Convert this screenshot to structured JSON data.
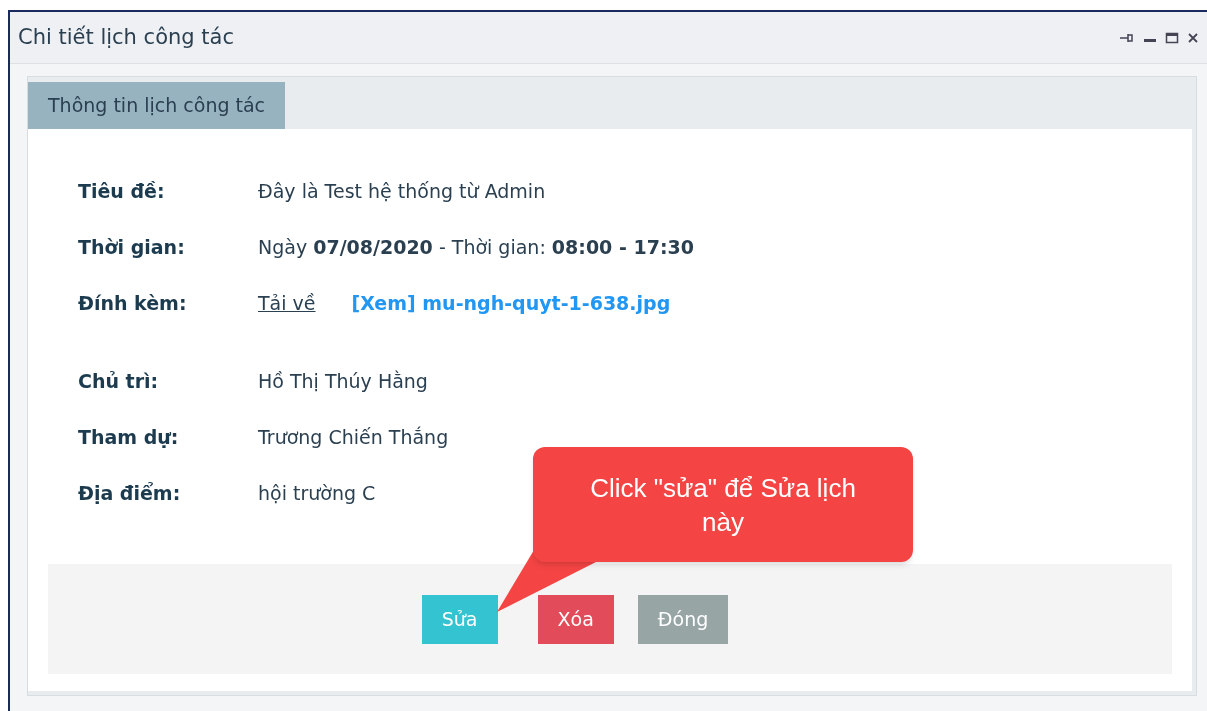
{
  "window": {
    "title": "Chi tiết lịch công tác"
  },
  "tabs": [
    {
      "label": "Thông tin lịch công tác",
      "selected": true
    }
  ],
  "details": [
    {
      "kind": "text",
      "label": "Tiêu đề:",
      "value": "Đây là Test hệ thống từ Admin"
    },
    {
      "kind": "text",
      "label": "Thời gian:",
      "value": "Ngày **07/08/2020** - Thời gian: **08:00 - 17:30**"
    },
    {
      "kind": "attachment",
      "label": "Đính kèm:",
      "download": "Tải về",
      "file": "[Xem] mu-ngh-quyt-1-638.jpg"
    }
  ],
  "people": [
    {
      "kind": "text",
      "label": "Chủ trì:",
      "value": "Hồ Thị Thúy Hằng"
    },
    {
      "kind": "text",
      "label": "Tham dự:",
      "value": "Trương Chiến Thắng"
    },
    {
      "kind": "text",
      "label": "Địa điểm:",
      "value": "hội trường C"
    }
  ],
  "buttons": [
    {
      "kind": "edit",
      "label": "Sửa"
    },
    {
      "kind": "delete",
      "label": "Xóa"
    },
    {
      "kind": "close",
      "label": "Đóng"
    }
  ],
  "callout": {
    "text": "Click \"sửa\" để Sửa lịch này"
  }
}
